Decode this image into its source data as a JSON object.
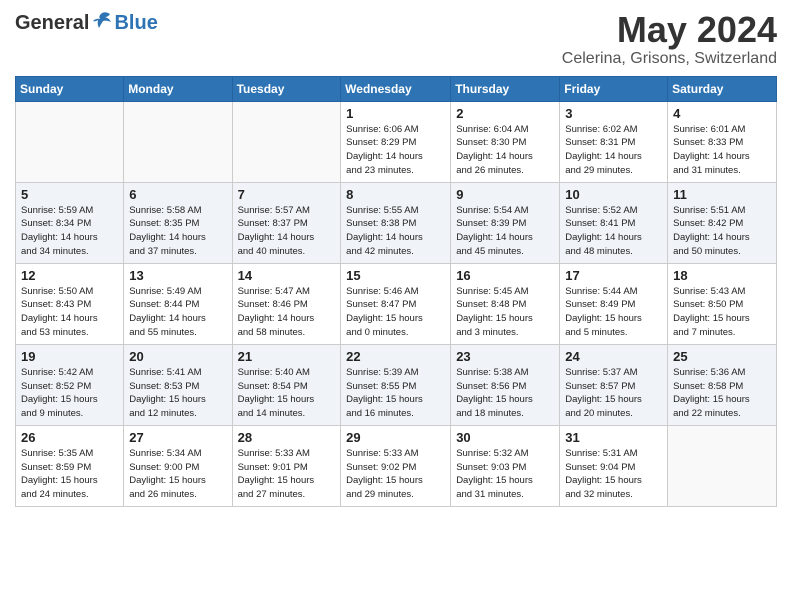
{
  "header": {
    "logo_general": "General",
    "logo_blue": "Blue",
    "month": "May 2024",
    "location": "Celerina, Grisons, Switzerland"
  },
  "days_of_week": [
    "Sunday",
    "Monday",
    "Tuesday",
    "Wednesday",
    "Thursday",
    "Friday",
    "Saturday"
  ],
  "weeks": [
    [
      {
        "day": "",
        "info": ""
      },
      {
        "day": "",
        "info": ""
      },
      {
        "day": "",
        "info": ""
      },
      {
        "day": "1",
        "info": "Sunrise: 6:06 AM\nSunset: 8:29 PM\nDaylight: 14 hours\nand 23 minutes."
      },
      {
        "day": "2",
        "info": "Sunrise: 6:04 AM\nSunset: 8:30 PM\nDaylight: 14 hours\nand 26 minutes."
      },
      {
        "day": "3",
        "info": "Sunrise: 6:02 AM\nSunset: 8:31 PM\nDaylight: 14 hours\nand 29 minutes."
      },
      {
        "day": "4",
        "info": "Sunrise: 6:01 AM\nSunset: 8:33 PM\nDaylight: 14 hours\nand 31 minutes."
      }
    ],
    [
      {
        "day": "5",
        "info": "Sunrise: 5:59 AM\nSunset: 8:34 PM\nDaylight: 14 hours\nand 34 minutes."
      },
      {
        "day": "6",
        "info": "Sunrise: 5:58 AM\nSunset: 8:35 PM\nDaylight: 14 hours\nand 37 minutes."
      },
      {
        "day": "7",
        "info": "Sunrise: 5:57 AM\nSunset: 8:37 PM\nDaylight: 14 hours\nand 40 minutes."
      },
      {
        "day": "8",
        "info": "Sunrise: 5:55 AM\nSunset: 8:38 PM\nDaylight: 14 hours\nand 42 minutes."
      },
      {
        "day": "9",
        "info": "Sunrise: 5:54 AM\nSunset: 8:39 PM\nDaylight: 14 hours\nand 45 minutes."
      },
      {
        "day": "10",
        "info": "Sunrise: 5:52 AM\nSunset: 8:41 PM\nDaylight: 14 hours\nand 48 minutes."
      },
      {
        "day": "11",
        "info": "Sunrise: 5:51 AM\nSunset: 8:42 PM\nDaylight: 14 hours\nand 50 minutes."
      }
    ],
    [
      {
        "day": "12",
        "info": "Sunrise: 5:50 AM\nSunset: 8:43 PM\nDaylight: 14 hours\nand 53 minutes."
      },
      {
        "day": "13",
        "info": "Sunrise: 5:49 AM\nSunset: 8:44 PM\nDaylight: 14 hours\nand 55 minutes."
      },
      {
        "day": "14",
        "info": "Sunrise: 5:47 AM\nSunset: 8:46 PM\nDaylight: 14 hours\nand 58 minutes."
      },
      {
        "day": "15",
        "info": "Sunrise: 5:46 AM\nSunset: 8:47 PM\nDaylight: 15 hours\nand 0 minutes."
      },
      {
        "day": "16",
        "info": "Sunrise: 5:45 AM\nSunset: 8:48 PM\nDaylight: 15 hours\nand 3 minutes."
      },
      {
        "day": "17",
        "info": "Sunrise: 5:44 AM\nSunset: 8:49 PM\nDaylight: 15 hours\nand 5 minutes."
      },
      {
        "day": "18",
        "info": "Sunrise: 5:43 AM\nSunset: 8:50 PM\nDaylight: 15 hours\nand 7 minutes."
      }
    ],
    [
      {
        "day": "19",
        "info": "Sunrise: 5:42 AM\nSunset: 8:52 PM\nDaylight: 15 hours\nand 9 minutes."
      },
      {
        "day": "20",
        "info": "Sunrise: 5:41 AM\nSunset: 8:53 PM\nDaylight: 15 hours\nand 12 minutes."
      },
      {
        "day": "21",
        "info": "Sunrise: 5:40 AM\nSunset: 8:54 PM\nDaylight: 15 hours\nand 14 minutes."
      },
      {
        "day": "22",
        "info": "Sunrise: 5:39 AM\nSunset: 8:55 PM\nDaylight: 15 hours\nand 16 minutes."
      },
      {
        "day": "23",
        "info": "Sunrise: 5:38 AM\nSunset: 8:56 PM\nDaylight: 15 hours\nand 18 minutes."
      },
      {
        "day": "24",
        "info": "Sunrise: 5:37 AM\nSunset: 8:57 PM\nDaylight: 15 hours\nand 20 minutes."
      },
      {
        "day": "25",
        "info": "Sunrise: 5:36 AM\nSunset: 8:58 PM\nDaylight: 15 hours\nand 22 minutes."
      }
    ],
    [
      {
        "day": "26",
        "info": "Sunrise: 5:35 AM\nSunset: 8:59 PM\nDaylight: 15 hours\nand 24 minutes."
      },
      {
        "day": "27",
        "info": "Sunrise: 5:34 AM\nSunset: 9:00 PM\nDaylight: 15 hours\nand 26 minutes."
      },
      {
        "day": "28",
        "info": "Sunrise: 5:33 AM\nSunset: 9:01 PM\nDaylight: 15 hours\nand 27 minutes."
      },
      {
        "day": "29",
        "info": "Sunrise: 5:33 AM\nSunset: 9:02 PM\nDaylight: 15 hours\nand 29 minutes."
      },
      {
        "day": "30",
        "info": "Sunrise: 5:32 AM\nSunset: 9:03 PM\nDaylight: 15 hours\nand 31 minutes."
      },
      {
        "day": "31",
        "info": "Sunrise: 5:31 AM\nSunset: 9:04 PM\nDaylight: 15 hours\nand 32 minutes."
      },
      {
        "day": "",
        "info": ""
      }
    ]
  ]
}
